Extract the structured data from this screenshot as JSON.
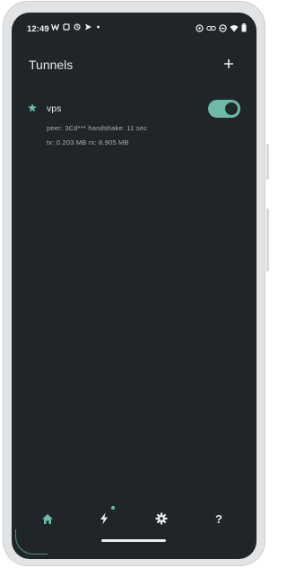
{
  "status_bar": {
    "time": "12:49",
    "left_icons": [
      "w-icon",
      "square-icon",
      "sync-icon",
      "send-icon",
      "dot-icon"
    ],
    "right_icons": [
      "vpn-key-icon",
      "link-icon",
      "do-not-disturb-icon",
      "wifi-icon",
      "battery-icon"
    ]
  },
  "app_bar": {
    "title": "Tunnels",
    "add_label": "+"
  },
  "tunnels": [
    {
      "name": "vps",
      "peer_line": "peer: 3Cd*** handshake: 11 sec",
      "transfer_line": "tx: 0.203 MB  rx: 8.905 MB",
      "enabled": true
    }
  ],
  "bottom_nav": {
    "items": [
      "home-icon",
      "bolt-icon",
      "settings-icon",
      "help-icon"
    ],
    "help_label": "?"
  },
  "colors": {
    "accent": "#6fb9ab",
    "background": "#1f2528",
    "text_primary": "#e8eaed",
    "text_secondary": "#a9b0b3"
  }
}
